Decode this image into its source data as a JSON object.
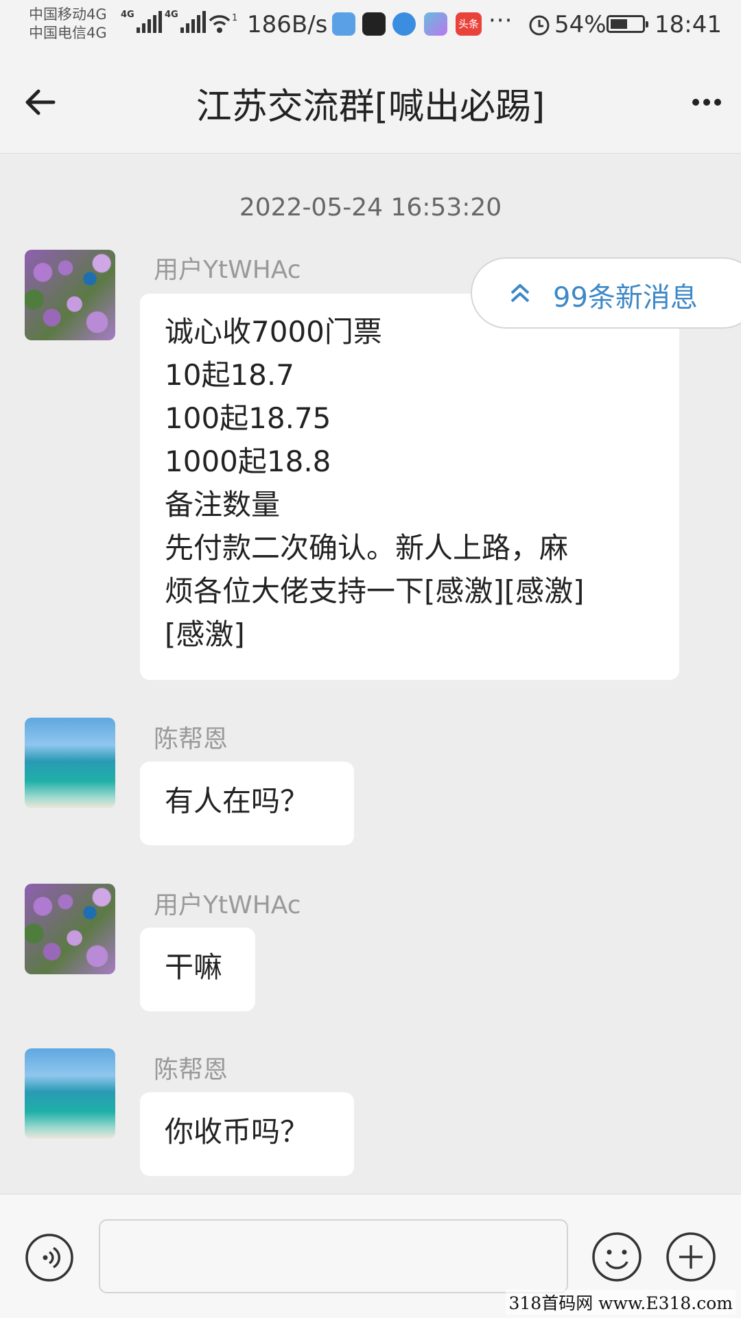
{
  "status_bar": {
    "carrier1": "中国移动4G",
    "carrier2": "中国电信4G",
    "signal_label": "4G",
    "speed": "186B/s",
    "more": "···",
    "app_badge": "头条",
    "battery_percent": "54%",
    "battery_level": 0.54,
    "time": "18:41",
    "wifi_badge": "1"
  },
  "nav": {
    "back_icon": "arrow-left-icon",
    "title": "江苏交流群[喊出必踢]",
    "more_icon": "more-horizontal-icon"
  },
  "chat": {
    "timestamp": "2022-05-24 16:53:20",
    "new_messages": "99条新消息",
    "messages": [
      {
        "sender": "用户YtWHAc",
        "lines": [
          "诚心收7000门票",
          "10起18.7",
          "100起18.75",
          "1000起18.8",
          "备注数量",
          "先付款二次确认。新人上路，麻",
          "烦各位大佬支持一下[感激][感激]",
          "[感激]"
        ]
      },
      {
        "sender": "陈帮恩",
        "lines": [
          "有人在吗？"
        ]
      },
      {
        "sender": "用户YtWHAc",
        "lines": [
          "干嘛"
        ]
      },
      {
        "sender": "陈帮恩",
        "lines": [
          "你收币吗？"
        ]
      }
    ]
  },
  "input_bar": {
    "voice_icon": "voice-icon",
    "input_value": "",
    "emoji_icon": "emoji-icon",
    "plus_icon": "plus-icon"
  },
  "watermark": "318首码网 www.E318.com",
  "colors": {
    "background": "#ededed",
    "bubble": "#ffffff",
    "accent": "#3d88c6"
  }
}
